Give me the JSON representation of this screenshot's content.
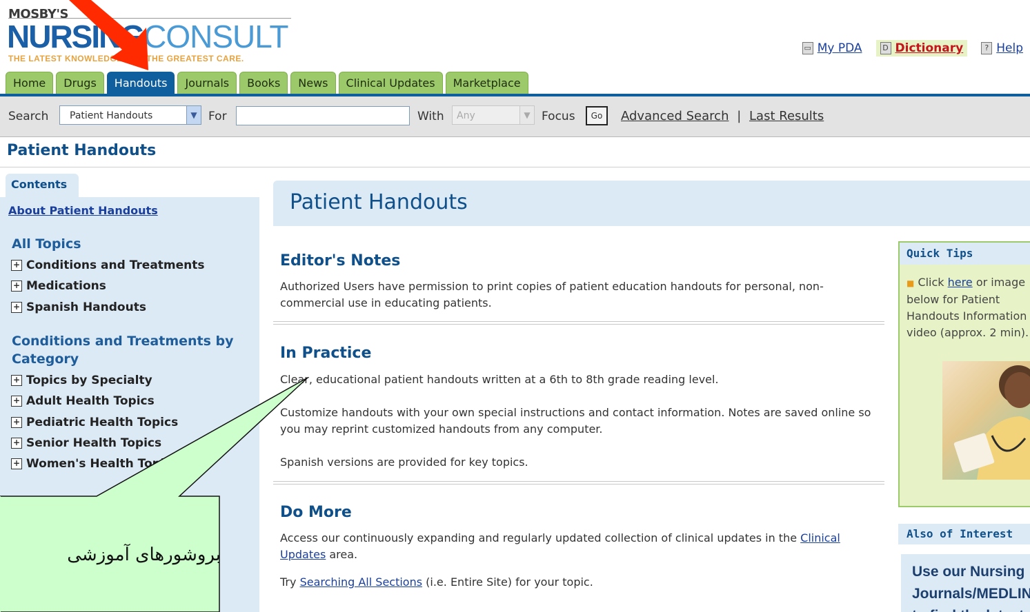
{
  "logo": {
    "brand_top": "MOSBY'S",
    "brand_bold": "NURSING",
    "brand_light": "CONSULT",
    "tagline": "THE LATEST KNOWLEDGE FOR THE GREATEST CARE."
  },
  "top_links": {
    "my_pda": "My PDA",
    "dictionary": "Dictionary",
    "help": "Help"
  },
  "tabs": [
    {
      "label": "Home",
      "active": false
    },
    {
      "label": "Drugs",
      "active": false
    },
    {
      "label": "Handouts",
      "active": true
    },
    {
      "label": "Journals",
      "active": false
    },
    {
      "label": "Books",
      "active": false
    },
    {
      "label": "News",
      "active": false
    },
    {
      "label": "Clinical Updates",
      "active": false
    },
    {
      "label": "Marketplace",
      "active": false
    }
  ],
  "search": {
    "search_label": "Search",
    "search_scope": "Patient Handouts",
    "for_label": "For",
    "query": "",
    "with_label": "With",
    "with_value": "Any",
    "focus_label": "Focus",
    "go_label": "Go",
    "advanced_label": "Advanced Search",
    "separator": "|",
    "last_results_label": "Last Results"
  },
  "page_title": "Patient Handouts",
  "sidebar": {
    "tab_label": "Contents",
    "about_link": "About Patient Handouts",
    "all_topics_heading": "All Topics",
    "all_topics": [
      "Conditions and Treatments",
      "Medications",
      "Spanish Handouts"
    ],
    "category_heading": "Conditions and Treatments by Category",
    "category_items": [
      "Topics by Specialty",
      "Adult Health Topics",
      "Pediatric Health Topics",
      "Senior Health Topics",
      "Women's Health Topics"
    ]
  },
  "main": {
    "title": "Patient Handouts",
    "editors_notes": {
      "heading": "Editor's Notes",
      "text": "Authorized Users have permission to print copies of patient education handouts for personal, non-commercial use in educating patients."
    },
    "in_practice": {
      "heading": "In Practice",
      "p1": "Clear, educational patient handouts written at a 6th to 8th grade reading level.",
      "p2": "Customize handouts with your own special instructions and contact information. Notes are saved online so you may reprint customized handouts from any computer.",
      "p3": "Spanish versions are provided for key topics."
    },
    "do_more": {
      "heading": "Do More",
      "p1_before": "Access our continuously expanding and regularly updated collection of clinical updates in the",
      "p1_link": "Clinical Updates",
      "p1_after": "area.",
      "p2_before": "Try",
      "p2_link": "Searching All Sections",
      "p2_after": "(i.e. Entire Site) for your topic."
    }
  },
  "quick_tips": {
    "heading": "Quick Tips",
    "bullet_before": "Click",
    "bullet_link": "here",
    "bullet_after": "or image below for Patient Handouts Information video (approx. 2 min)."
  },
  "also_of_interest": {
    "heading": "Also of Interest",
    "line1": "Use our Nursing",
    "line2": "Journals/MEDLINE",
    "line3": "to find the latest"
  },
  "callout": {
    "text": "بروشورهای آموزشی"
  },
  "colors": {
    "brand_blue": "#0f5f9e",
    "tab_green": "#9cc96a",
    "panel_blue": "#dceaf6",
    "callout_green": "#ccffcc",
    "arrow_red": "#ff2a00"
  }
}
